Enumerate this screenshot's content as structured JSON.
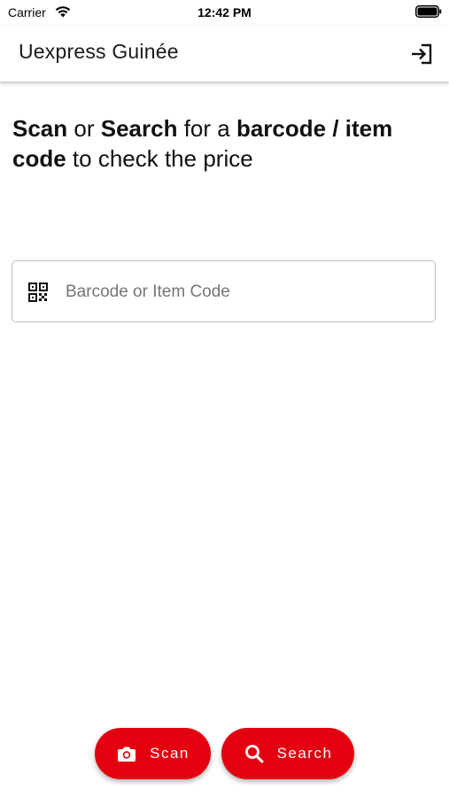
{
  "status_bar": {
    "carrier": "Carrier",
    "time": "12:42 PM",
    "icons": [
      "wifi-icon",
      "battery-icon"
    ]
  },
  "app_bar": {
    "title": "Uexpress Guinée",
    "action_icon": "logout-icon"
  },
  "headline": {
    "part1": "Scan",
    "part2": " or ",
    "part3": "Search",
    "part4": " for a ",
    "part5": "barcode / item code",
    "part6": " to check the price"
  },
  "search": {
    "icon": "qr-code-icon",
    "placeholder": "Barcode or Item Code",
    "value": ""
  },
  "actions": {
    "scan_label": "Scan",
    "scan_icon": "camera-icon",
    "search_label": "Search",
    "search_icon": "search-icon"
  },
  "colors": {
    "accent": "#e3000f",
    "background": "#ffffff"
  }
}
